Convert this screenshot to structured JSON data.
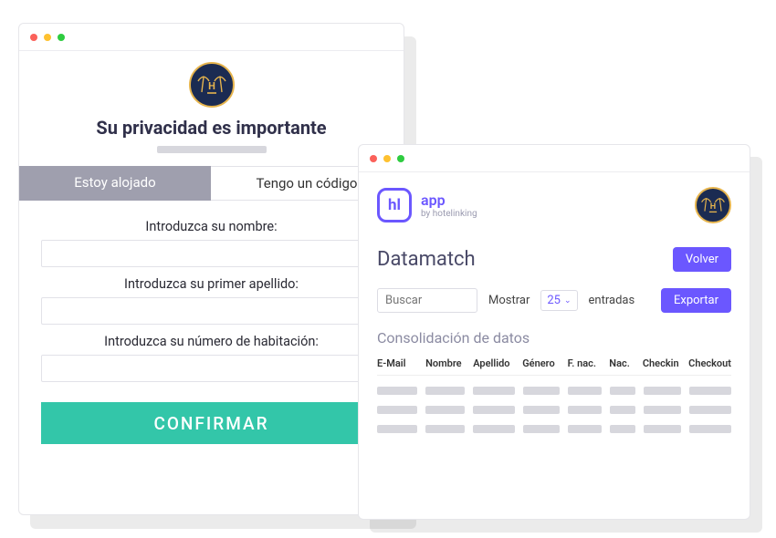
{
  "left": {
    "title": "Su privacidad es importante",
    "tabs": {
      "active": "Estoy alojado",
      "inactive": "Tengo un código"
    },
    "labels": {
      "name": "Introduzca su nombre:",
      "surname": "Introduzca su primer apellido:",
      "room": "Introduzca su número de habitación:"
    },
    "inputs": {
      "name": "",
      "surname": "",
      "room": ""
    },
    "confirm": "CONFIRMAR"
  },
  "right": {
    "app": {
      "name": "app",
      "subtitle": "by hotelinking",
      "logo_text": "hl"
    },
    "section": "Datamatch",
    "buttons": {
      "back": "Volver",
      "export": "Exportar"
    },
    "search_placeholder": "Buscar",
    "show_label": "Mostrar",
    "count": "25",
    "entries_label": "entradas",
    "table_title": "Consolidación de datos",
    "columns": {
      "email": "E-Mail",
      "nombre": "Nombre",
      "apellido": "Apellido",
      "genero": "Género",
      "fnac": "F. nac.",
      "nac": "Nac.",
      "checkin": "Checkin",
      "checkout": "Checkout"
    }
  },
  "colors": {
    "accent": "#6b57ff",
    "confirm": "#33c6a9",
    "badge_bg": "#1b2b52",
    "badge_ring": "#e6b44d"
  }
}
